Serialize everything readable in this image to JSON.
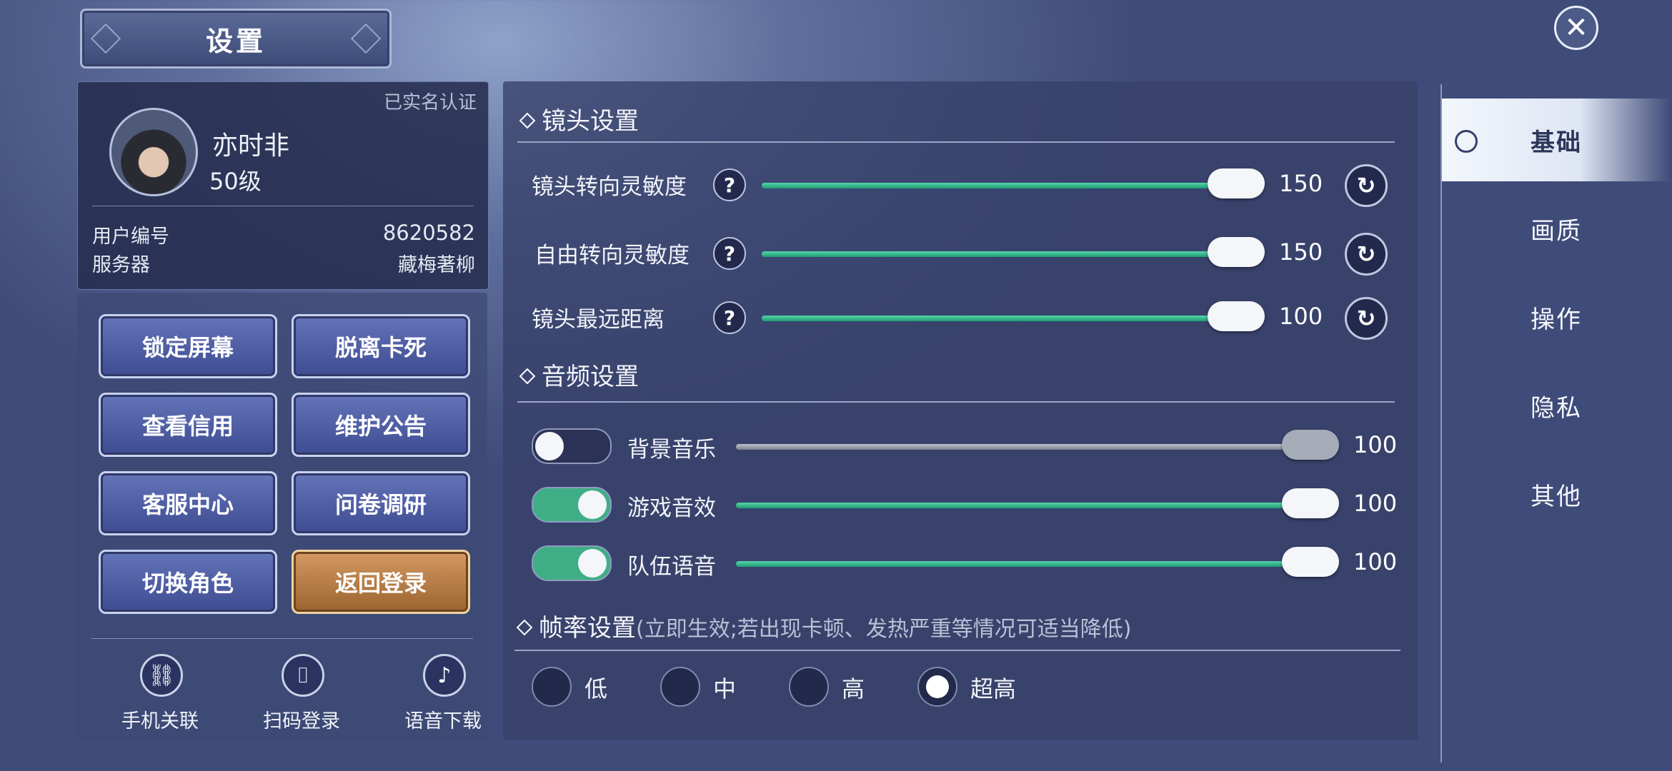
{
  "header": {
    "title": "设置",
    "close_icon": "close-x-icon"
  },
  "profile": {
    "verified": "已实名认证",
    "name": "亦时非",
    "level": "50级",
    "user_id_label": "用户编号",
    "user_id": "8620582",
    "server_label": "服务器",
    "server": "藏梅著柳"
  },
  "actions": [
    "锁定屏幕",
    "脱离卡死",
    "查看信用",
    "维护公告",
    "客服中心",
    "问卷调研",
    "切换角色",
    "返回登录"
  ],
  "quick_links": [
    {
      "label": "手机关联",
      "icon": "link-icon"
    },
    {
      "label": "扫码登录",
      "icon": "scan-icon"
    },
    {
      "label": "语音下载",
      "icon": "music-note-icon"
    }
  ],
  "camera": {
    "title": "镜头设置",
    "rows": [
      {
        "label": "镜头转向灵敏度",
        "value": "150",
        "fraction": 0.94
      },
      {
        "label": "自由转向灵敏度",
        "value": "150",
        "fraction": 0.94
      },
      {
        "label": "镜头最远距离",
        "value": "100",
        "fraction": 0.94
      }
    ],
    "help_symbol": "?",
    "reset_symbol": "↻"
  },
  "audio": {
    "title": "音频设置",
    "rows": [
      {
        "label": "背景音乐",
        "value": "100",
        "enabled": false
      },
      {
        "label": "游戏音效",
        "value": "100",
        "enabled": true
      },
      {
        "label": "队伍语音",
        "value": "100",
        "enabled": true
      }
    ]
  },
  "framerate": {
    "title": "帧率设置",
    "hint": "(立即生效;若出现卡顿、发热严重等情况可适当降低)",
    "options": [
      "低",
      "中",
      "高",
      "超高"
    ],
    "selected": "超高"
  },
  "tabs": [
    "基础",
    "画质",
    "操作",
    "隐私",
    "其他"
  ],
  "active_tab": "基础",
  "colors": {
    "accent_green": "#3fae86",
    "panel": "#364068",
    "orange_button": "#b87a43"
  }
}
